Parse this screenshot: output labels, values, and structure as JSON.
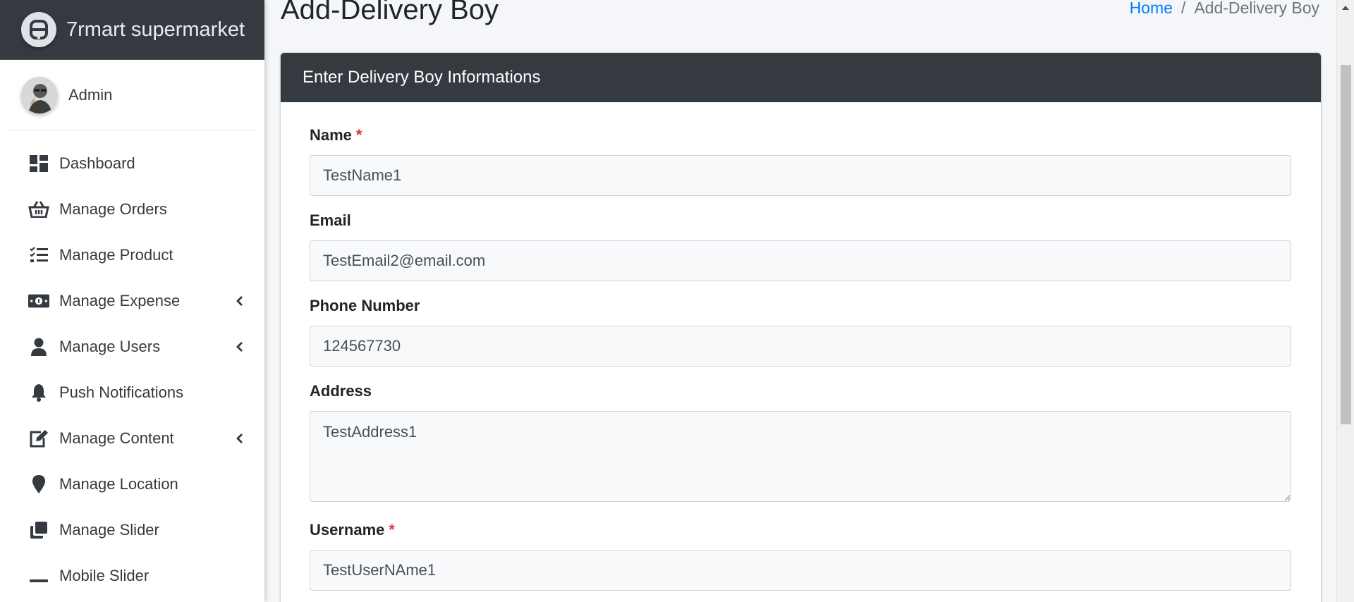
{
  "brand": {
    "name": "7rmart supermarket"
  },
  "user": {
    "name": "Admin"
  },
  "sidebar": {
    "items": [
      {
        "label": "Dashboard",
        "icon": "dashboard-icon",
        "has_children": false
      },
      {
        "label": "Manage Orders",
        "icon": "basket-icon",
        "has_children": false
      },
      {
        "label": "Manage Product",
        "icon": "tasks-icon",
        "has_children": false
      },
      {
        "label": "Manage Expense",
        "icon": "money-bill-icon",
        "has_children": true
      },
      {
        "label": "Manage Users",
        "icon": "user-icon",
        "has_children": true
      },
      {
        "label": "Push Notifications",
        "icon": "bell-icon",
        "has_children": false
      },
      {
        "label": "Manage Content",
        "icon": "edit-icon",
        "has_children": true
      },
      {
        "label": "Manage Location",
        "icon": "map-marker-icon",
        "has_children": false
      },
      {
        "label": "Manage Slider",
        "icon": "clone-icon",
        "has_children": false
      },
      {
        "label": "Mobile Slider",
        "icon": "minus-icon",
        "has_children": false
      }
    ]
  },
  "page": {
    "title": "Add-Delivery Boy",
    "breadcrumb": {
      "home": "Home",
      "separator": "/",
      "current": "Add-Delivery Boy"
    }
  },
  "form": {
    "header": "Enter Delivery Boy Informations",
    "required_mark": "*",
    "fields": {
      "name": {
        "label": "Name",
        "value": "TestName1",
        "required": true
      },
      "email": {
        "label": "Email",
        "value": "TestEmail2@email.com",
        "required": false
      },
      "phone": {
        "label": "Phone Number",
        "value": "124567730",
        "required": false
      },
      "address": {
        "label": "Address",
        "value": "TestAddress1",
        "required": false
      },
      "username": {
        "label": "Username",
        "value": "TestUserNAme1",
        "required": true
      }
    }
  },
  "colors": {
    "brand_bg": "#343a40",
    "link": "#007bff",
    "required": "#dc3545",
    "page_bg": "#f4f6f9"
  }
}
